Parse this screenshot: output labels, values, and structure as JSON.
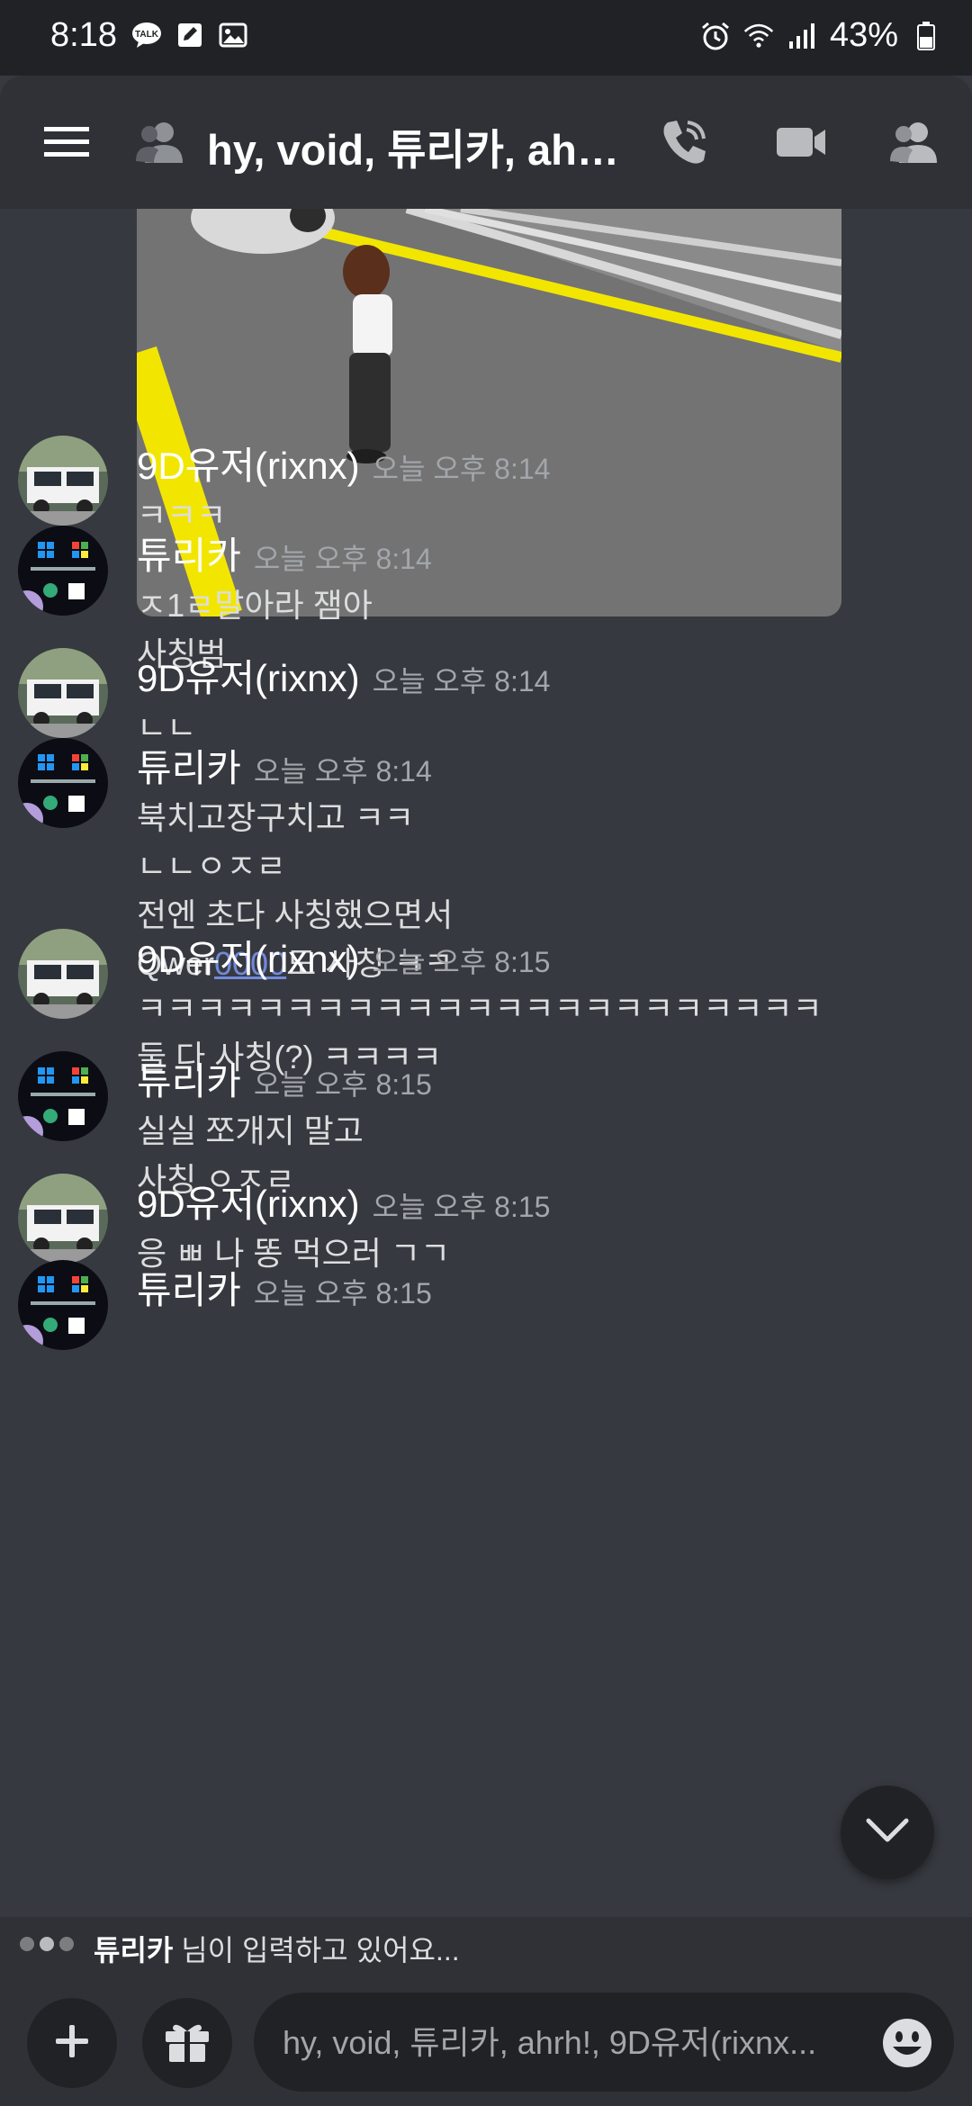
{
  "status_bar": {
    "time": "8:18",
    "battery": "43%",
    "left_icons": [
      "kakaotalk-icon",
      "edit-icon",
      "gallery-icon"
    ],
    "right_icons": [
      "alarm-icon",
      "wifi-icon",
      "signal-icon",
      "battery-icon"
    ]
  },
  "header": {
    "title": "hy, void, 튜리카, ahrh!, 9D유저(rixnx)",
    "icons": [
      "menu-icon",
      "group-dm-icon",
      "call-icon",
      "video-icon",
      "members-icon"
    ]
  },
  "messages": [
    {
      "author": "9D유저(rixnx)",
      "timestamp": "오늘 오후 8:14",
      "avatar": "truck",
      "lines": [
        "ㅋㅋㅋ"
      ]
    },
    {
      "author": "튜리카",
      "timestamp": "오늘 오후 8:14",
      "avatar": "windows",
      "lines": [
        "ㅈ1ㄹ말아라 잼아",
        "사칭범"
      ]
    },
    {
      "author": "9D유저(rixnx)",
      "timestamp": "오늘 오후 8:14",
      "avatar": "truck",
      "lines": [
        "ㄴㄴ"
      ]
    },
    {
      "author": "튜리카",
      "timestamp": "오늘 오후 8:14",
      "avatar": "windows",
      "lines": [
        "북치고장구치고 ㅋㅋ",
        "ㄴㄴㅇㅈㄹ",
        "전엔 초다 사칭했으면서"
      ],
      "mention_line": {
        "before": "Qwer",
        "mention": "0000",
        "after": "도 사칭 ㅋㅋ"
      }
    },
    {
      "author": "9D유저(rixnx)",
      "timestamp": "오늘 오후 8:15",
      "avatar": "truck",
      "lines": [
        "ㅋㅋㅋㅋㅋㅋㅋㅋㅋㅋㅋㅋㅋㅋㅋㅋㅋㅋㅋㅋㅋㅋㅋ",
        "둘 다 사칭(?) ㅋㅋㅋㅋ"
      ]
    },
    {
      "author": "튜리카",
      "timestamp": "오늘 오후 8:15",
      "avatar": "windows",
      "lines": [
        "실실 쪼개지 말고",
        "사칭 ㅇㅈㄹ"
      ]
    },
    {
      "author": "9D유저(rixnx)",
      "timestamp": "오늘 오후 8:15",
      "avatar": "truck",
      "lines": [
        "응 ㅃ 나 똥 먹으러 ㄱㄱ"
      ]
    },
    {
      "author": "튜리카",
      "timestamp": "오늘 오후 8:15",
      "avatar": "windows",
      "lines": []
    }
  ],
  "typing": {
    "name": "튜리카",
    "suffix": " 님이 입력하고 있어요..."
  },
  "composer": {
    "placeholder": "hy, void, 튜리카, ahrh!, 9D유저(rixnx...",
    "buttons": [
      "plus-icon",
      "gift-icon",
      "emoji-icon"
    ]
  },
  "colors": {
    "background": "#36393f",
    "header": "#2f3136",
    "mention": "#7289da",
    "timestamp": "#a3a6aa"
  }
}
